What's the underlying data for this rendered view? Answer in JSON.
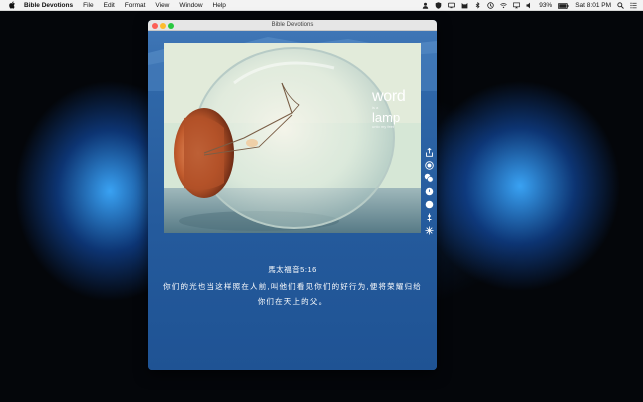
{
  "menubar": {
    "app_name": "Bible Devotions",
    "menus": [
      "File",
      "Edit",
      "Format",
      "View",
      "Window",
      "Help"
    ],
    "battery": "93%",
    "clock": "Sat 8:01 PM"
  },
  "window": {
    "title": "Bible Devotions",
    "image_text": {
      "line1": "word",
      "small1": "is a",
      "line2": "lamp",
      "small2": "unto my feet"
    },
    "verse_ref": "馬太福音5:16",
    "verse_text": "你们的光也当这样照在人前,叫他们看见你们的好行为,便将荣耀归给你们在天上的父。"
  },
  "toolbar_icons": [
    "share-icon",
    "record-icon",
    "overlap-icon",
    "circle-icon",
    "dot-icon",
    "brightness-icon",
    "sparkle-icon"
  ]
}
